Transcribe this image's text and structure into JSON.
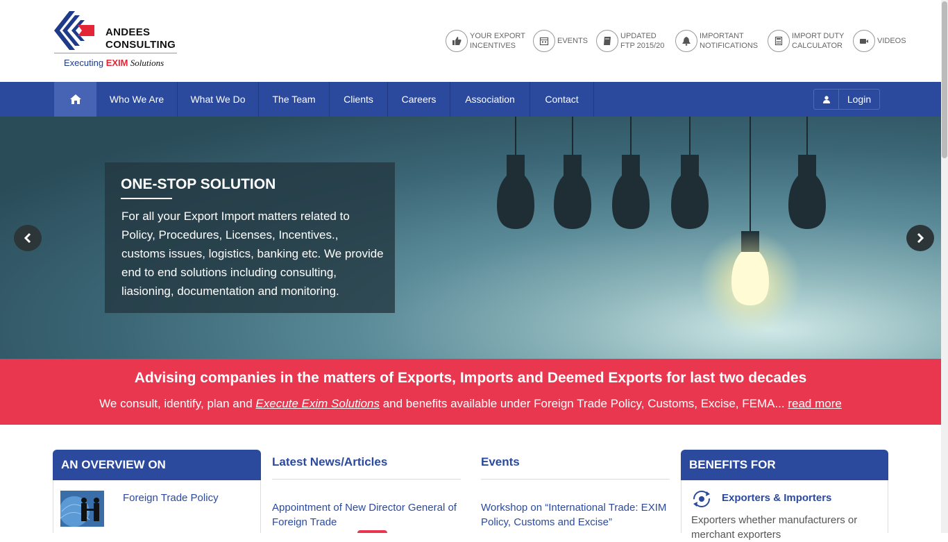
{
  "brand": {
    "name_line1": "ANDEES",
    "name_line2": "CONSULTING",
    "tagline_pre": "Executing ",
    "tagline_highlight": "EXIM",
    "tagline_post": " Solutions",
    "colors": {
      "blue": "#1e3b8a",
      "red": "#e32636"
    }
  },
  "quick_links": [
    {
      "icon": "thumbs-up-icon",
      "line1": "YOUR EXPORT",
      "line2": "INCENTIVES"
    },
    {
      "icon": "calendar-icon",
      "line1": "EVENTS",
      "line2": ""
    },
    {
      "icon": "book-icon",
      "line1": "UPDATED",
      "line2": "FTP 2015/20"
    },
    {
      "icon": "bell-icon",
      "line1": "IMPORTANT",
      "line2": "NOTIFICATIONS"
    },
    {
      "icon": "calculator-icon",
      "line1": "IMPORT DUTY",
      "line2": "CALCULATOR"
    },
    {
      "icon": "video-camera-icon",
      "line1": "VIDEOS",
      "line2": ""
    }
  ],
  "nav": {
    "items": [
      "Who We Are",
      "What We Do",
      "The Team",
      "Clients",
      "Careers",
      "Association",
      "Contact"
    ],
    "login_label": "Login",
    "color": "#2b4a9e"
  },
  "hero": {
    "title": "ONE-STOP SOLUTION",
    "text": "For all your Export Import matters related to Policy, Procedures, Licenses, Incentives., customs issues, logistics, banking etc. We provide end to end solutions including consulting, liasioning, documentation and monitoring."
  },
  "band": {
    "headline": "Advising companies in the matters of Exports, Imports and Deemed Exports for last two decades",
    "text_pre": "We consult, identify, plan and ",
    "text_link": "Execute Exim Solutions",
    "text_post": " and benefits available under Foreign Trade Policy, Customs, Excise, FEMA... ",
    "read_more": "read more",
    "color": "#e8374f"
  },
  "overview": {
    "title": "AN OVERVIEW ON",
    "item": "Foreign Trade Policy"
  },
  "news": {
    "title": "Latest News/Articles",
    "item": "Appointment of New Director General of Foreign Trade"
  },
  "events": {
    "title": "Events",
    "item": "Workshop on “International Trade: EXIM Policy, Customs and Excise”"
  },
  "benefits": {
    "title": "BENEFITS FOR",
    "item_title": "Exporters & Importers",
    "item_text": "Exporters whether manufacturers or merchant exporters"
  }
}
